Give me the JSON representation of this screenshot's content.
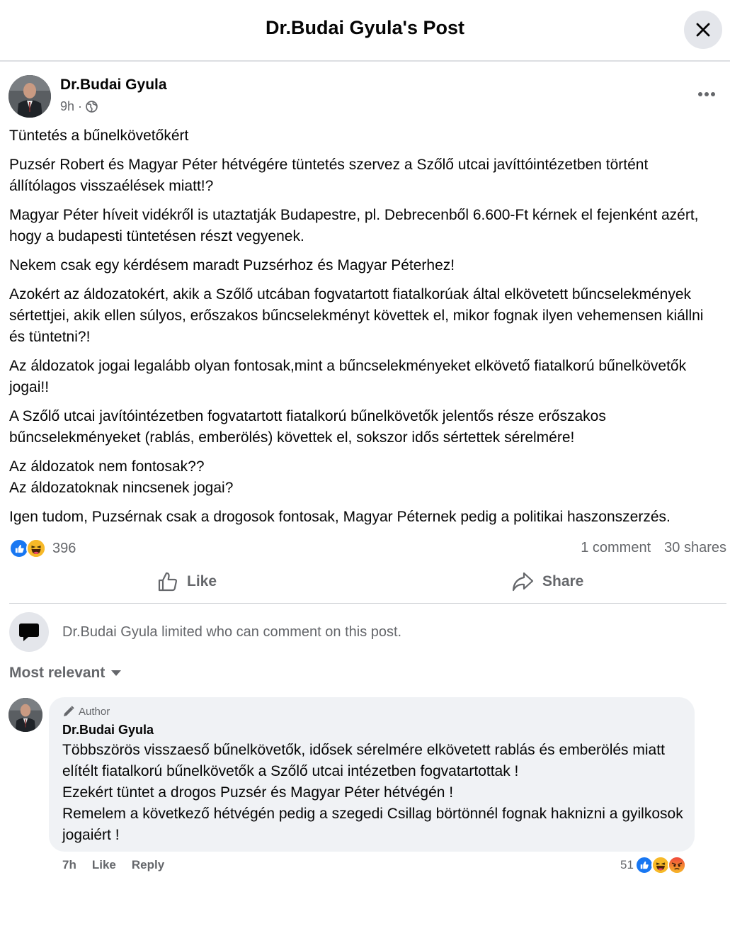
{
  "header": {
    "title": "Dr.Budai Gyula's Post"
  },
  "post": {
    "author": "Dr.Budai Gyula",
    "time": "9h",
    "separator": "·",
    "paragraphs": [
      "Tüntetés a bűnelkövetőkért",
      "Puzsér Robert és Magyar Péter hétvégére tüntetés szervez a Szőlő utcai javíttóintézetben történt állítólagos visszaélések miatt!?",
      "Magyar Péter híveit vidékről is utaztatják Budapestre, pl. Debrecenből 6.600-Ft kérnek el fejenként azért, hogy a budapesti tüntetésen részt vegyenek.",
      "Nekem csak egy kérdésem maradt Puzsérhoz és Magyar Péterhez!",
      "Azokért az áldozatokért, akik a Szőlő utcában fogvatartott fiatalkorúak által elkövetett bűncselekmények sértettjei, akik ellen súlyos, erőszakos bűncselekményt követtek el, mikor fognak ilyen vehemensen kiállni és tüntetni?!",
      "Az áldozatok jogai legalább olyan fontosak,mint a bűncselekményeket elkövető fiatalkorú bűnelkövetők jogai!!",
      "A Szőlő utcai javítóintézetben fogvatartott fiatalkorú bűnelkövetők jelentős része erőszakos bűncselekményeket (rablás, emberölés) követtek el, sokszor idős sértettek sérelmére!",
      "Az áldozatok nem fontosak??",
      "Az áldozatoknak nincsenek jogai?",
      "Igen tudom, Puzsérnak csak a drogosok fontosak, Magyar Péternek pedig a politikai haszonszerzés."
    ],
    "reaction_count": "396",
    "comments_count": "1 comment",
    "shares_count": "30 shares",
    "like_label": "Like",
    "share_label": "Share"
  },
  "comments_section": {
    "limit_notice": "Dr.Budai Gyula limited who can comment on this post.",
    "sort_label": "Most relevant"
  },
  "comment": {
    "badge": "Author",
    "author": "Dr.Budai Gyula",
    "lines": [
      "Többszörös visszaeső bűnelkövetők, idősek sérelmére elkövetett rablás és emberölés miatt elítélt fiatalkorú bűnelkövetők a Szőlő utcai intézetben fogvatartottak !",
      "Ezekért tüntet a drogos Puzsér és Magyar Péter hétvégén !",
      "Remelem a következő hétvégén pedig a szegedi Csillag börtönnél fognak haknizni a gyilkosok jogaiért !"
    ],
    "time": "7h",
    "like_label": "Like",
    "reply_label": "Reply",
    "reaction_count": "51"
  },
  "colors": {
    "like_blue": "#1877f2",
    "haha_yellow": "#f7b928",
    "angry_orange": "#e9710f",
    "secondary_text": "#65676b"
  },
  "icons": [
    "close-icon",
    "globe-icon",
    "more-icon",
    "like-reaction-icon",
    "haha-reaction-icon",
    "angry-reaction-icon",
    "thumbs-up-icon",
    "share-arrow-icon",
    "speech-bubble-icon",
    "caret-down-icon",
    "pencil-icon"
  ]
}
